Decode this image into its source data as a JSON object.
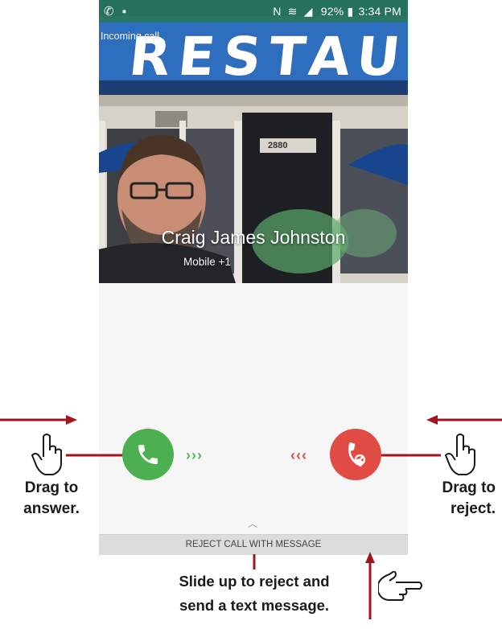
{
  "status_bar": {
    "time": "3:34 PM",
    "battery": "92%"
  },
  "call": {
    "incoming_label": "Incoming call",
    "caller_name": "Craig James Johnston",
    "caller_sub": "Mobile +1",
    "photo_sign": "RESTAUR",
    "door_number": "2880"
  },
  "controls": {
    "answer_chevrons": "›››",
    "reject_chevrons": "‹‹‹",
    "reject_message_label": "REJECT CALL WITH MESSAGE"
  },
  "callouts": {
    "answer_line1": "Drag to",
    "answer_line2": "answer.",
    "reject_line1": "Drag to",
    "reject_line2": "reject.",
    "message_line1": "Slide up to reject and",
    "message_line2": "send a text message."
  },
  "colors": {
    "answer_green": "#4caf50",
    "reject_red": "#e04b43",
    "callout_arrow": "#a3151e"
  },
  "icons": [
    "phone-icon",
    "reject-call-icon",
    "pointing-hand-icon",
    "chevron-up-icon",
    "wifi-icon",
    "signal-icon",
    "battery-icon",
    "nfc-icon"
  ]
}
